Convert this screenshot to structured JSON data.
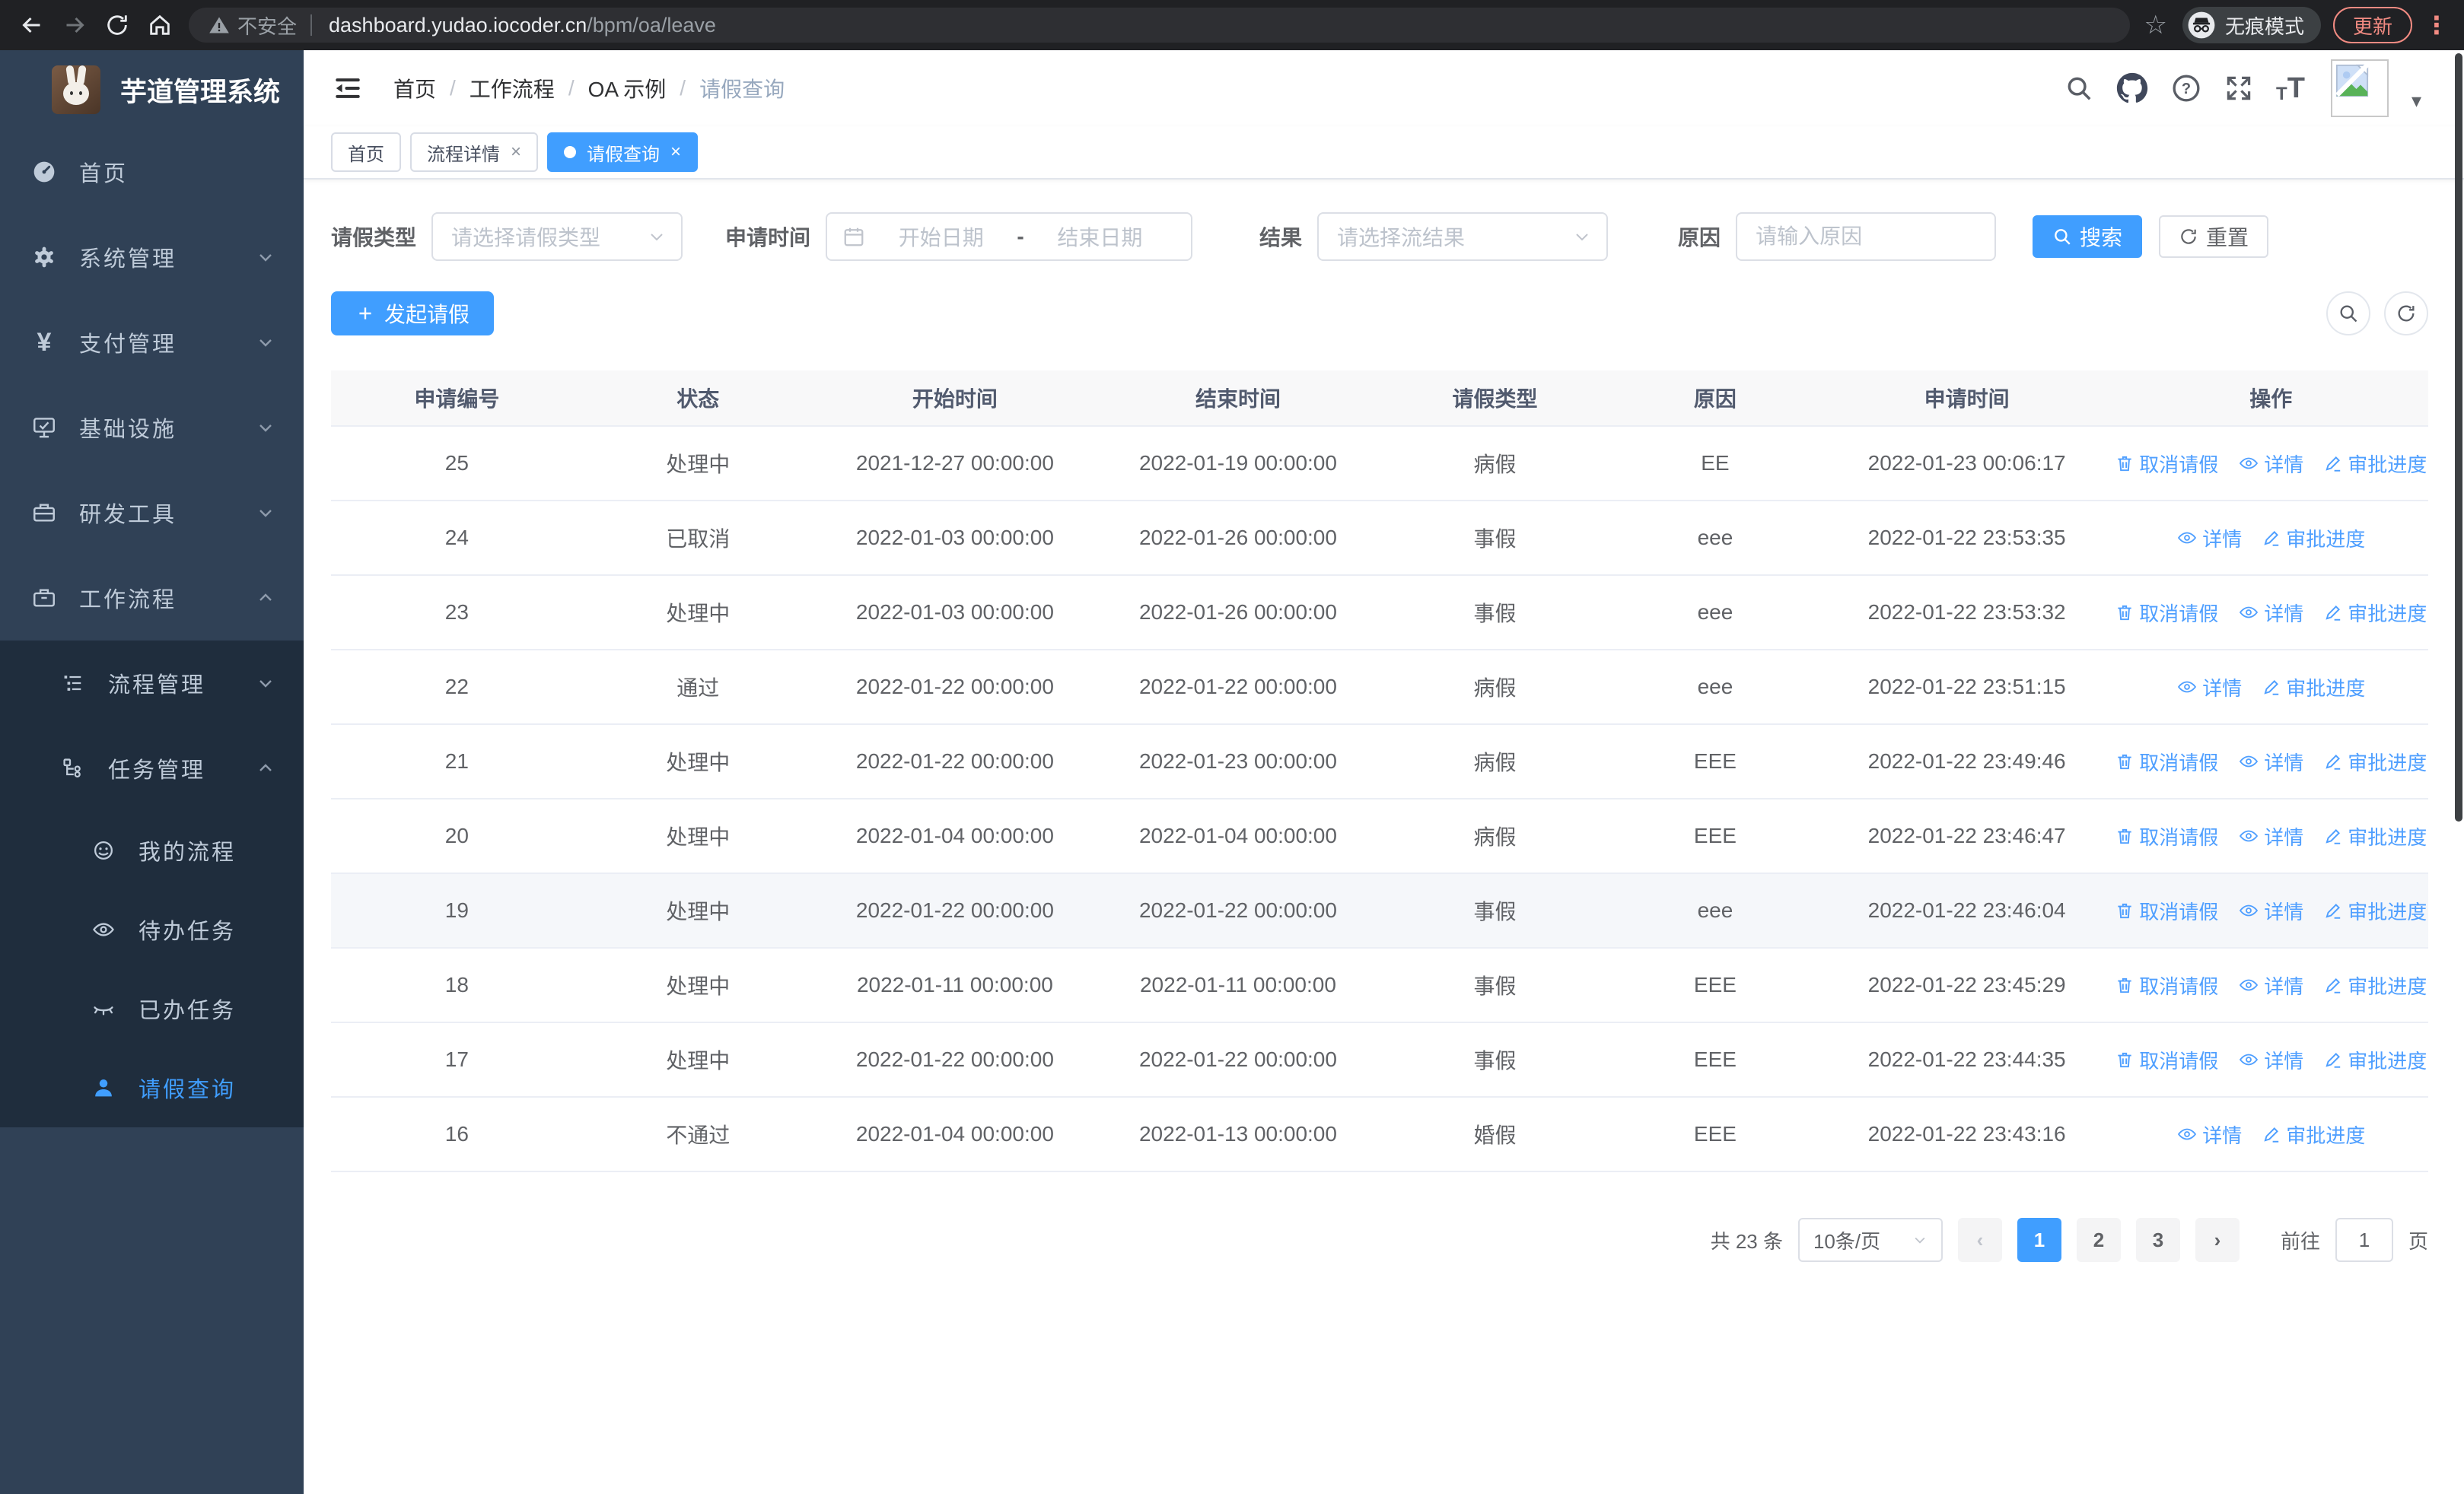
{
  "browser": {
    "security_label": "不安全",
    "url_host": "dashboard.yudao.iocoder.cn",
    "url_path": "/bpm/oa/leave",
    "incognito_label": "无痕模式",
    "update_label": "更新"
  },
  "icons": {
    "close": "×",
    "prev": "‹",
    "next": "›",
    "help": "?",
    "yen": "¥",
    "font_small": "T",
    "font_large": "T",
    "caret": "▾",
    "dots": "⋮",
    "star": "☆"
  },
  "sidebar": {
    "title": "芋道管理系统",
    "items": [
      {
        "label": "首页",
        "icon": "dashboard-icon"
      },
      {
        "label": "系统管理",
        "icon": "gear-icon"
      },
      {
        "label": "支付管理",
        "icon": "yen-icon"
      },
      {
        "label": "基础设施",
        "icon": "monitor-icon"
      },
      {
        "label": "研发工具",
        "icon": "toolbox-icon"
      },
      {
        "label": "工作流程",
        "icon": "briefcase-icon"
      },
      {
        "label": "流程管理",
        "icon": "list-tree-icon"
      },
      {
        "label": "任务管理",
        "icon": "flow-icon"
      },
      {
        "label": "我的流程",
        "icon": "robot-icon"
      },
      {
        "label": "待办任务",
        "icon": "eye-icon"
      },
      {
        "label": "已办任务",
        "icon": "eye-closed-icon"
      },
      {
        "label": "请假查询",
        "icon": "user-icon"
      }
    ]
  },
  "breadcrumb": [
    "首页",
    "工作流程",
    "OA 示例",
    "请假查询"
  ],
  "breadcrumb_separator": "/",
  "tabs": [
    {
      "label": "首页"
    },
    {
      "label": "流程详情"
    },
    {
      "label": "请假查询"
    }
  ],
  "filters": {
    "type_label": "请假类型",
    "type_placeholder": "请选择请假类型",
    "time_label": "申请时间",
    "date_start_placeholder": "开始日期",
    "date_separator": "-",
    "date_end_placeholder": "结束日期",
    "result_label": "结果",
    "result_placeholder": "请选择流结果",
    "reason_label": "原因",
    "reason_placeholder": "请输入原因",
    "search_label": "搜索",
    "reset_label": "重置"
  },
  "toolbar": {
    "create_label": "发起请假"
  },
  "table": {
    "columns": [
      "申请编号",
      "状态",
      "开始时间",
      "结束时间",
      "请假类型",
      "原因",
      "申请时间",
      "操作"
    ],
    "action_labels": {
      "cancel": "取消请假",
      "detail": "详情",
      "progress": "审批进度"
    },
    "rows": [
      {
        "id": "25",
        "status": "处理中",
        "start": "2021-12-27 00:00:00",
        "end": "2022-01-19 00:00:00",
        "type": "病假",
        "reason": "EE",
        "apply": "2022-01-23 00:06:17",
        "highlight": false,
        "actions": [
          "cancel",
          "detail",
          "progress"
        ]
      },
      {
        "id": "24",
        "status": "已取消",
        "start": "2022-01-03 00:00:00",
        "end": "2022-01-26 00:00:00",
        "type": "事假",
        "reason": "eee",
        "apply": "2022-01-22 23:53:35",
        "highlight": false,
        "actions": [
          "detail",
          "progress"
        ]
      },
      {
        "id": "23",
        "status": "处理中",
        "start": "2022-01-03 00:00:00",
        "end": "2022-01-26 00:00:00",
        "type": "事假",
        "reason": "eee",
        "apply": "2022-01-22 23:53:32",
        "highlight": false,
        "actions": [
          "cancel",
          "detail",
          "progress"
        ]
      },
      {
        "id": "22",
        "status": "通过",
        "start": "2022-01-22 00:00:00",
        "end": "2022-01-22 00:00:00",
        "type": "病假",
        "reason": "eee",
        "apply": "2022-01-22 23:51:15",
        "highlight": false,
        "actions": [
          "detail",
          "progress"
        ]
      },
      {
        "id": "21",
        "status": "处理中",
        "start": "2022-01-22 00:00:00",
        "end": "2022-01-23 00:00:00",
        "type": "病假",
        "reason": "EEE",
        "apply": "2022-01-22 23:49:46",
        "highlight": false,
        "actions": [
          "cancel",
          "detail",
          "progress"
        ]
      },
      {
        "id": "20",
        "status": "处理中",
        "start": "2022-01-04 00:00:00",
        "end": "2022-01-04 00:00:00",
        "type": "病假",
        "reason": "EEE",
        "apply": "2022-01-22 23:46:47",
        "highlight": false,
        "actions": [
          "cancel",
          "detail",
          "progress"
        ]
      },
      {
        "id": "19",
        "status": "处理中",
        "start": "2022-01-22 00:00:00",
        "end": "2022-01-22 00:00:00",
        "type": "事假",
        "reason": "eee",
        "apply": "2022-01-22 23:46:04",
        "highlight": true,
        "actions": [
          "cancel",
          "detail",
          "progress"
        ]
      },
      {
        "id": "18",
        "status": "处理中",
        "start": "2022-01-11 00:00:00",
        "end": "2022-01-11 00:00:00",
        "type": "事假",
        "reason": "EEE",
        "apply": "2022-01-22 23:45:29",
        "highlight": false,
        "actions": [
          "cancel",
          "detail",
          "progress"
        ]
      },
      {
        "id": "17",
        "status": "处理中",
        "start": "2022-01-22 00:00:00",
        "end": "2022-01-22 00:00:00",
        "type": "事假",
        "reason": "EEE",
        "apply": "2022-01-22 23:44:35",
        "highlight": false,
        "actions": [
          "cancel",
          "detail",
          "progress"
        ]
      },
      {
        "id": "16",
        "status": "不通过",
        "start": "2022-01-04 00:00:00",
        "end": "2022-01-13 00:00:00",
        "type": "婚假",
        "reason": "EEE",
        "apply": "2022-01-22 23:43:16",
        "highlight": false,
        "actions": [
          "detail",
          "progress"
        ]
      }
    ]
  },
  "pagination": {
    "total_label": "共 23 条",
    "page_size": "10条/页",
    "pages": [
      "1",
      "2",
      "3"
    ],
    "active_page": "1",
    "goto_label": "前往",
    "goto_value": "1",
    "page_suffix_label": "页"
  }
}
